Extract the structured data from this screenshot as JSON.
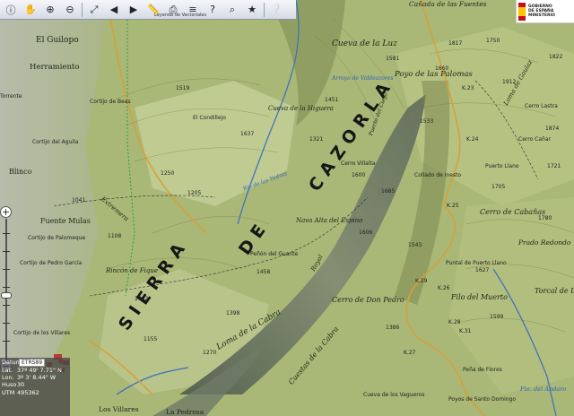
{
  "toolbar": {
    "buttons": [
      "info-icon",
      "pan-hand-icon",
      "zoom-in-icon",
      "zoom-out-icon",
      "full-extent-icon",
      "previous-extent-icon",
      "next-extent-icon",
      "measure-icon",
      "print-icon",
      "layers-icon",
      "identify-icon",
      "search-icon",
      "favorite-icon",
      "help-icon",
      "grid-icon",
      "coords-icon",
      "home-icon",
      "clear-icon"
    ],
    "leyenda_label": "Leyenda de Vectoriales"
  },
  "coords": {
    "datum_label": "Datum",
    "datum_value": "ETRS89",
    "lat_label": "Lat.",
    "lat_value": "37º 49' 7.71\" N",
    "lon_label": "Lon.",
    "lon_value": "3º 3' 8.44\" W",
    "huso_label": "Huso",
    "huso_value": "30",
    "utm_label": "UTM",
    "utm_value": "495362"
  },
  "logo": {
    "line1": "GOBIERNO",
    "line2": "DE ESPAÑA",
    "line3": "MINISTERIO"
  },
  "map": {
    "big_label_1": "SIERRA",
    "big_label_2": "DE",
    "big_label_3": "CAZORLA",
    "places": [
      "El Guilopo",
      "Herramiento",
      "Cortijo de Beas",
      "Cortijo del Aguila",
      "Torrente",
      "Blinco",
      "Fuente Mulas",
      "Cortijo de Palomeque",
      "Cortijo de Pedro García",
      "Cortijo de los Villares",
      "El Condillejo",
      "Cueva de la Higuera",
      "Cueva de la Luz",
      "Poyo de las Palomas",
      "Cañada de las Fuentes",
      "Cerro Villalta",
      "Collado de Inesto",
      "Nava Alta del Espino",
      "Peñón del Guante",
      "Rincón de Fique",
      "Cerro de Don Pedro",
      "Filo del Muerto",
      "Peña de Flores",
      "Cerro de Cabañas",
      "Prado Redondo",
      "Torcal de Linar",
      "Cerro Lastra",
      "Cerro Cañar",
      "Puerto Llano",
      "Puntal de Puerto Llano",
      "Cueva de los Vagueros",
      "Loma de Gaulaz",
      "Los Villares",
      "La Pedrosa",
      "Poyos de Santo Domingo"
    ],
    "roads": [
      "Extremera",
      "Loma de la Cabra",
      "Cuestas de la Cabra",
      "Royal",
      "Puerto del Ciego"
    ],
    "rivers": [
      "Arroyo de Valdeazores",
      "Río de las Yedras",
      "Fte. del Ándaro"
    ],
    "road_codes": [
      "K.29",
      "K.25",
      "K.26",
      "K.27",
      "K.28",
      "K.31",
      "K.24",
      "K.23"
    ],
    "elevations": [
      "1402",
      "1519",
      "1637",
      "1581",
      "1660",
      "1750",
      "1721",
      "1685",
      "1606",
      "1458",
      "1398",
      "1205",
      "1250",
      "1321",
      "1451",
      "1533",
      "1817",
      "1912",
      "1874",
      "1705",
      "1543",
      "1627",
      "1599",
      "1386",
      "1270",
      "1155",
      "1108",
      "1041",
      "1600",
      "1780",
      "1822"
    ]
  },
  "colors": {
    "terrain_base": "#a9b777",
    "terrain_light": "#c8d29b",
    "terrain_dark": "#5f6f3c",
    "ridge_shadow": "#4b5a48",
    "water": "#2f63b8",
    "road": "#d7a63c",
    "contour": "#8a7040"
  }
}
